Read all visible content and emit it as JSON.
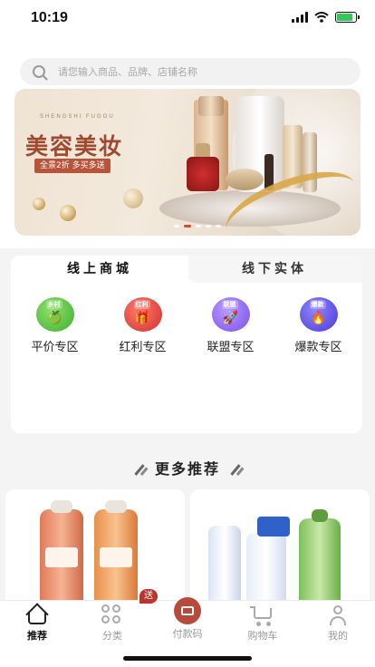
{
  "status_bar": {
    "time": "10:19"
  },
  "search": {
    "placeholder": "请您输入商品、品牌、店铺名称"
  },
  "banner": {
    "subtitle": "SHENGSHI FUGOU",
    "title": "美容美妆",
    "tag": "全景2折 多买多送",
    "slide_count": 5,
    "active_slide": 2
  },
  "channel": {
    "tabs": [
      {
        "label": "线上商城",
        "active": true
      },
      {
        "label": "线下实体",
        "active": false
      }
    ],
    "zones": [
      {
        "label": "平价专区",
        "badge": "乡村",
        "color": "#5fbf4a",
        "icon": "apple-icon"
      },
      {
        "label": "红利专区",
        "badge": "红利",
        "color": "#e04848",
        "icon": "gift-icon"
      },
      {
        "label": "联盟专区",
        "badge": "联盟",
        "color": "#8a5ff0",
        "icon": "rocket-icon"
      },
      {
        "label": "爆款专区",
        "badge": "爆款",
        "color": "#5a46e0",
        "icon": "flame-icon"
      }
    ]
  },
  "recommend": {
    "title": "更多推荐",
    "gift_tag": "送"
  },
  "tab_bar": {
    "items": [
      {
        "label": "推荐",
        "active": true,
        "icon": "home-icon"
      },
      {
        "label": "分类",
        "active": false,
        "icon": "category-icon"
      },
      {
        "label": "付款码",
        "active": false,
        "icon": "pay-code-icon"
      },
      {
        "label": "购物车",
        "active": false,
        "icon": "cart-icon"
      },
      {
        "label": "我的",
        "active": false,
        "icon": "profile-icon"
      }
    ]
  },
  "colors": {
    "accent": "#b84a3b",
    "banner_title": "#a1492e",
    "background": "#f4f4f5"
  }
}
